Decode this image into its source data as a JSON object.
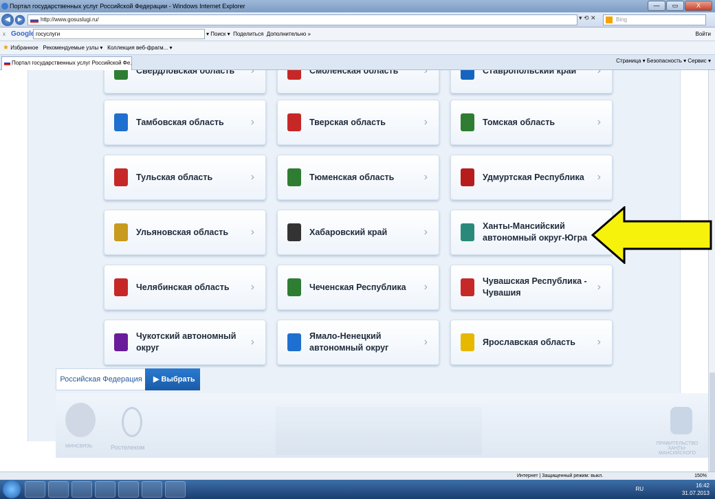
{
  "window": {
    "title": "Портал государственных услуг Российской Федерации - Windows Internet Explorer",
    "controls": [
      "—",
      "▭",
      "X"
    ]
  },
  "address": {
    "url": "http://www.gosuslugi.ru/",
    "search_placeholder": "Bing"
  },
  "google_bar": {
    "close": "x",
    "logo": "Google",
    "query": "госуслуги",
    "search": "Поиск",
    "share": "Поделиться",
    "more": "Дополнительно »",
    "login": "Войти"
  },
  "favorites": {
    "label": "Избранное",
    "items": [
      "Рекомендуемые узлы ▾",
      "Коллекция веб-фрагм... ▾"
    ]
  },
  "tab": {
    "title": "Портал государственных услуг Российской Фе..."
  },
  "commands": {
    "text": "Страница ▾  Безопасность ▾  Сервис ▾"
  },
  "regions": [
    {
      "label": "Свердловская область",
      "color": "#2e7d32"
    },
    {
      "label": "Смоленская область",
      "color": "#c62828"
    },
    {
      "label": "Ставропольский край",
      "color": "#1565c0"
    },
    {
      "label": "Тамбовская область",
      "color": "#1e6fd0"
    },
    {
      "label": "Тверская область",
      "color": "#c62828"
    },
    {
      "label": "Томская область",
      "color": "#2e7d32"
    },
    {
      "label": "Тульская область",
      "color": "#c62828"
    },
    {
      "label": "Тюменская область",
      "color": "#2e7d32"
    },
    {
      "label": "Удмуртская Республика",
      "color": "#b71c1c"
    },
    {
      "label": "Ульяновская область",
      "color": "#c89b1e"
    },
    {
      "label": "Хабаровский край",
      "color": "#333333"
    },
    {
      "label": "Ханты-Мансийский автономный округ-Югра",
      "color": "#2a8a7a"
    },
    {
      "label": "Челябинская область",
      "color": "#c62828"
    },
    {
      "label": "Чеченская Республика",
      "color": "#2e7d32"
    },
    {
      "label": "Чувашская Республика - Чувашия",
      "color": "#c62828"
    },
    {
      "label": "Чукотский автономный округ",
      "color": "#6a1b9a"
    },
    {
      "label": "Ямало-Ненецкий автономный округ",
      "color": "#1e6fd0"
    },
    {
      "label": "Ярославская область",
      "color": "#e6b800"
    }
  ],
  "actions": {
    "federation": "Российская Федерация",
    "choose": "▶ Выбрать"
  },
  "footer": {
    "left_caption": "МИНСВЯЗЬ",
    "center_caption": "Ростелеком",
    "right_caption": "ПРАВИТЕЛЬСТВО ХАНТЫ-МАНСИЙСКОГО"
  },
  "status": {
    "zone": "Интернет | Защищенный режим: выкл.",
    "zoom": "150%"
  },
  "tray": {
    "lang": "RU",
    "time": "16:42",
    "date": "31.07.2013"
  },
  "accent": "#f7f20c"
}
